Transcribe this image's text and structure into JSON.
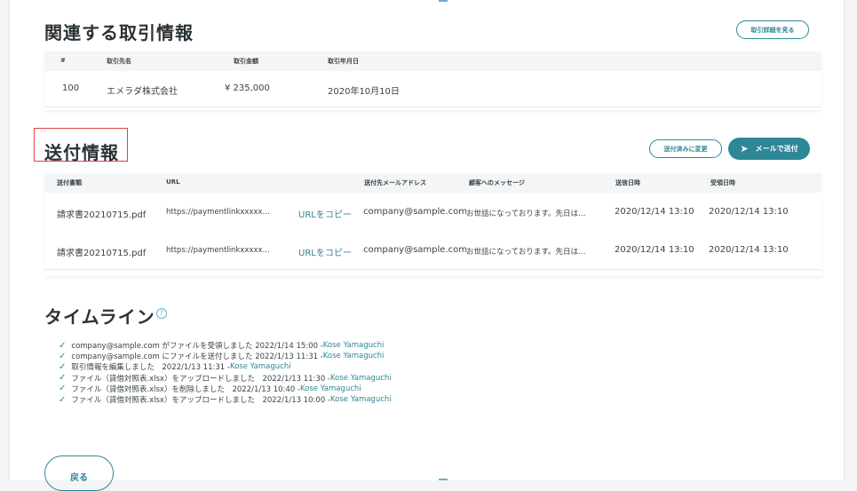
{
  "related": {
    "title": "関連する取引情報",
    "detail_button": "取引詳細を見る",
    "columns": [
      "#",
      "取引先名",
      "取引金額",
      "取引年月日"
    ],
    "rows": [
      [
        "100",
        "エメラダ株式会社",
        "¥ 235,000",
        "2020年10月10日"
      ]
    ]
  },
  "send": {
    "title": "送付情報",
    "mark_sent_button": "送付済みに変更",
    "send_mail_button": "メールで送付",
    "columns": [
      "送付書類",
      "URL",
      "",
      "送付先メールアドレス",
      "顧客へのメッセージ",
      "送信日時",
      "受領日時"
    ],
    "rows": [
      [
        "請求書20210715.pdf",
        "https://paymentlinkxxxxx…",
        "URLをコピー",
        "company@sample.com",
        "お世話になっております。先日は…",
        "2020/12/14 13:10",
        "2020/12/14 13:10"
      ],
      [
        "請求書20210715.pdf",
        "https://paymentlinkxxxxx…",
        "URLをコピー",
        "company@sample.com",
        "お世話になっております。先日は…",
        "2020/12/14 13:10",
        "2020/12/14 13:10"
      ]
    ]
  },
  "timeline": {
    "title": "タイムライン",
    "help_icon": "?",
    "items": [
      {
        "text": "company@sample.com がファイルを受領しました 2022/1/14 15:00 - ",
        "user": "Kose Yamaguchi"
      },
      {
        "text": "company@sample.com にファイルを送付しました 2022/1/13 11:31 - ",
        "user": "Kose Yamaguchi"
      },
      {
        "text": "取引情報を編集しました　2022/1/13 11:31 - ",
        "user": "Kose Yamaguchi"
      },
      {
        "text": "ファイル（貸借対照表.xlsx）をアップロードしました　2022/1/13 11:30 - ",
        "user": "Kose Yamaguchi"
      },
      {
        "text": "ファイル（貸借対照表.xlsx）を削除しました　2022/1/13 10:40 - ",
        "user": "Kose Yamaguchi"
      },
      {
        "text": "ファイル（貸借対照表.xlsx）をアップロードしました　2022/1/13 10:00 - ",
        "user": "Kose Yamaguchi"
      }
    ]
  },
  "back_button": "戻る",
  "colors": {
    "accent": "#2d8796",
    "highlight": "#e04141"
  }
}
